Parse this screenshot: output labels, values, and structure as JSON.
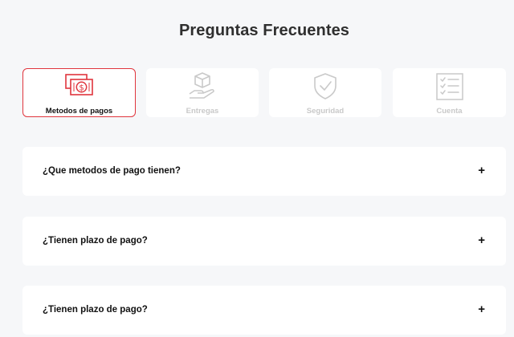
{
  "header": {
    "title": "Preguntas Frecuentes"
  },
  "categories": [
    {
      "label": "Metodos de pagos",
      "icon": "money-icon",
      "active": true
    },
    {
      "label": "Entregas",
      "icon": "package-hand-icon",
      "active": false
    },
    {
      "label": "Seguridad",
      "icon": "shield-check-icon",
      "active": false
    },
    {
      "label": "Cuenta",
      "icon": "checklist-icon",
      "active": false
    }
  ],
  "faqs": [
    {
      "question": "¿Que metodos de pago tienen?",
      "toggle": "+"
    },
    {
      "question": "¿Tienen plazo de pago?",
      "toggle": "+"
    },
    {
      "question": "¿Tienen plazo de pago?",
      "toggle": "+"
    }
  ],
  "colors": {
    "accent": "#e0353d",
    "inactive": "#c9c9c9",
    "background": "#f6f7f9"
  }
}
